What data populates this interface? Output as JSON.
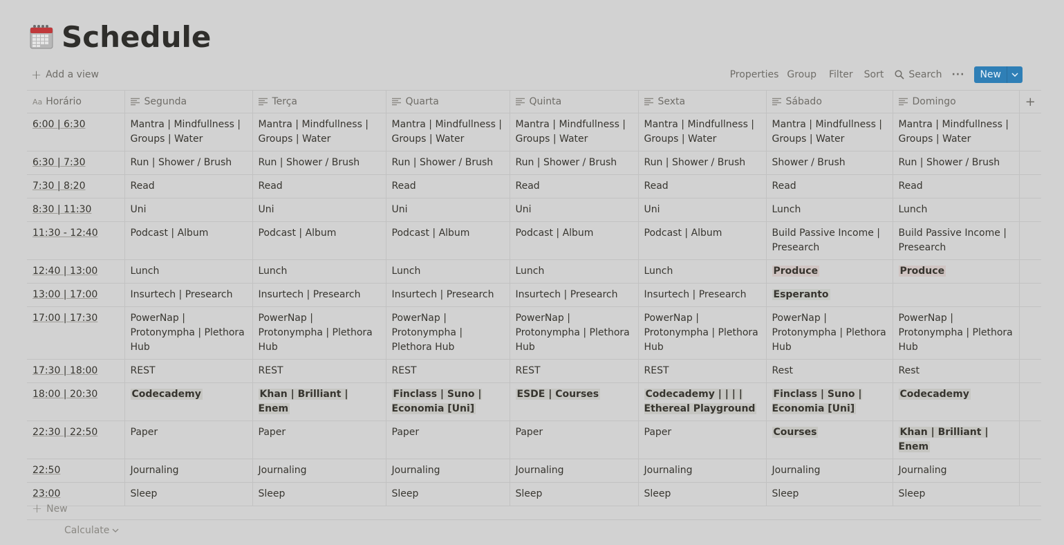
{
  "page": {
    "title": "Schedule",
    "icon": "calendar-icon"
  },
  "toolbar": {
    "add_view": "Add a view",
    "properties": "Properties",
    "group": "Group",
    "filter": "Filter",
    "sort": "Sort",
    "search": "Search",
    "more": "···",
    "new": "New"
  },
  "table": {
    "columns": [
      "Horário",
      "Segunda",
      "Terça",
      "Quarta",
      "Quinta",
      "Sexta",
      "Sábado",
      "Domingo"
    ],
    "rows": [
      [
        "6:00 | 6:30",
        "Mantra | Mindfullness | Groups | Water",
        "Mantra | Mindfullness | Groups | Water",
        "Mantra | Mindfullness | Groups | Water",
        "Mantra | Mindfullness | Groups | Water",
        "Mantra | Mindfullness | Groups | Water",
        "Mantra | Mindfullness | Groups | Water",
        "Mantra | Mindfullness | Groups | Water"
      ],
      [
        "6:30 | 7:30",
        "Run | Shower / Brush",
        "Run | Shower / Brush",
        "Run | Shower / Brush",
        "Run | Shower / Brush",
        "Run | Shower / Brush",
        "Shower / Brush",
        "Run | Shower / Brush"
      ],
      [
        "7:30 | 8:20",
        "Read",
        "Read",
        "Read",
        "Read",
        "Read",
        "Read",
        "Read"
      ],
      [
        "8:30 | 11:30",
        "Uni",
        "Uni",
        "Uni",
        "Uni",
        "Uni",
        "Lunch",
        "Lunch"
      ],
      [
        "11:30 - 12:40",
        "Podcast | Album",
        "Podcast | Album",
        "Podcast | Album",
        "Podcast | Album",
        "Podcast | Album",
        "Build Passive Income | Presearch",
        "Build Passive Income | Presearch"
      ],
      [
        "12:40 | 13:00",
        "Lunch",
        "Lunch",
        "Lunch",
        "Lunch",
        "Lunch",
        "Produce",
        "Produce"
      ],
      [
        "13:00 | 17:00",
        "Insurtech | Presearch",
        "Insurtech | Presearch",
        "Insurtech | Presearch",
        "Insurtech | Presearch",
        "Insurtech | Presearch",
        "Esperanto",
        ""
      ],
      [
        "17:00 | 17:30",
        "PowerNap | Protonympha | Plethora Hub",
        "PowerNap | Protonympha | Plethora Hub",
        "PowerNap | Protonympha | Plethora Hub",
        "PowerNap | Protonympha | Plethora Hub",
        "PowerNap | Protonympha | Plethora Hub",
        "PowerNap | Protonympha | Plethora Hub",
        "PowerNap | Protonympha | Plethora Hub"
      ],
      [
        "17:30 | 18:00",
        "REST",
        "REST",
        "REST",
        "REST",
        "REST",
        "Rest",
        "Rest"
      ],
      [
        "18:00 | 20:30",
        "Codecademy",
        "Khan | Brilliant | Enem",
        "Finclass | Suno | Economia [Uni]",
        "ESDE | Courses",
        "Codecademy | | | | Ethereal Playground",
        "Finclass | Suno | Economia [Uni]",
        "Codecademy"
      ],
      [
        "22:30 | 22:50",
        "Paper",
        "Paper",
        "Paper",
        "Paper",
        "Paper",
        "Courses",
        "Khan | Brilliant | Enem"
      ],
      [
        "22:50",
        "Journaling",
        "Journaling",
        "Journaling",
        "Journaling",
        "Journaling",
        "Journaling",
        "Journaling"
      ],
      [
        "23:00",
        "Sleep",
        "Sleep",
        "Sleep",
        "Sleep",
        "Sleep",
        "Sleep",
        "Sleep"
      ]
    ],
    "highlighted": [
      [
        5,
        6,
        "red"
      ],
      [
        5,
        7,
        "red"
      ],
      [
        6,
        6,
        "grn"
      ],
      [
        9,
        1,
        ""
      ],
      [
        9,
        2,
        ""
      ],
      [
        9,
        3,
        ""
      ],
      [
        9,
        4,
        ""
      ],
      [
        9,
        5,
        ""
      ],
      [
        9,
        6,
        ""
      ],
      [
        9,
        7,
        ""
      ],
      [
        10,
        6,
        ""
      ],
      [
        10,
        7,
        ""
      ]
    ]
  },
  "footer": {
    "new_row": "New",
    "calculate": "Calculate"
  },
  "colors": {
    "accent": "#2f7fb6",
    "background": "#d2d2d2"
  }
}
